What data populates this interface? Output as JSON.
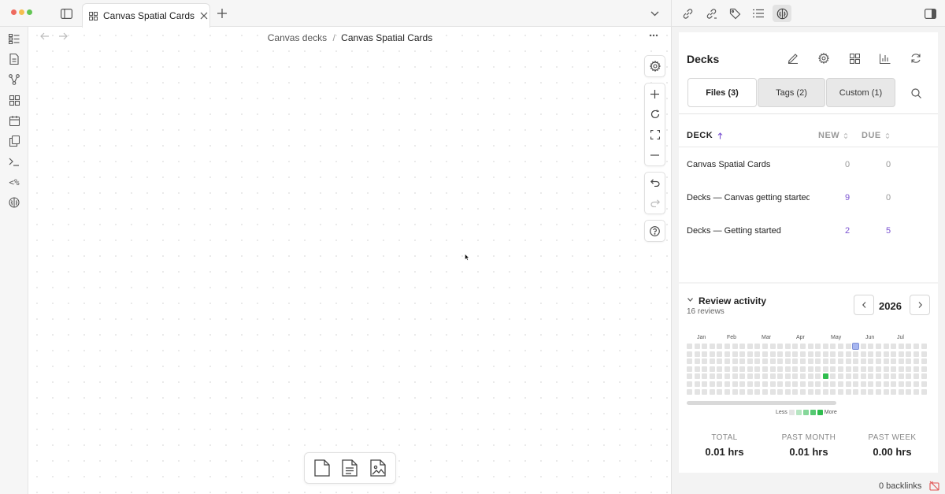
{
  "colors": {
    "traffic_red": "#ee6a5f",
    "traffic_yellow": "#f5be4f",
    "traffic_green": "#62c554",
    "accent_purple": "#7a52d1",
    "heat_green": "#2fbd4e",
    "heat_today": "#a7b6f0",
    "heat_empty": "#e3e3e3",
    "statusbar_red": "#e05252"
  },
  "tab": {
    "title": "Canvas Spatial Cards",
    "icon": "canvas-grid-icon"
  },
  "breadcrumb": {
    "parent": "Canvas decks",
    "separator": "/",
    "current": "Canvas Spatial Cards"
  },
  "ribbon": [
    "files-icon",
    "doc-icon",
    "graph-icon",
    "canvas-icon",
    "calendar-icon",
    "pages-icon",
    "terminal-icon",
    "template-icon",
    "brain-icon"
  ],
  "decks": {
    "title": "Decks",
    "tabs": [
      {
        "label": "Files (3)",
        "active": true
      },
      {
        "label": "Tags (2)",
        "active": false
      },
      {
        "label": "Custom (1)",
        "active": false
      }
    ],
    "columns": {
      "deck": "DECK",
      "new": "NEW",
      "due": "DUE"
    },
    "rows": [
      {
        "name": "Canvas Spatial Cards",
        "new": "0",
        "due": "0"
      },
      {
        "name": "Decks — Canvas getting started",
        "new": "9",
        "due": "0"
      },
      {
        "name": "Decks — Getting started",
        "new": "2",
        "due": "5"
      }
    ]
  },
  "activity": {
    "title": "Review activity",
    "subtitle": "16 reviews",
    "year": "2026",
    "months": [
      "Jan",
      "Feb",
      "Mar",
      "Apr",
      "May",
      "Jun",
      "Jul"
    ],
    "legend_less": "Less",
    "legend_more": "More",
    "stats": [
      {
        "label": "TOTAL",
        "value": "0.01 hrs"
      },
      {
        "label": "PAST MONTH",
        "value": "0.01 hrs"
      },
      {
        "label": "PAST WEEK",
        "value": "0.00 hrs"
      }
    ]
  },
  "statusbar": {
    "backlinks": "0 backlinks"
  }
}
